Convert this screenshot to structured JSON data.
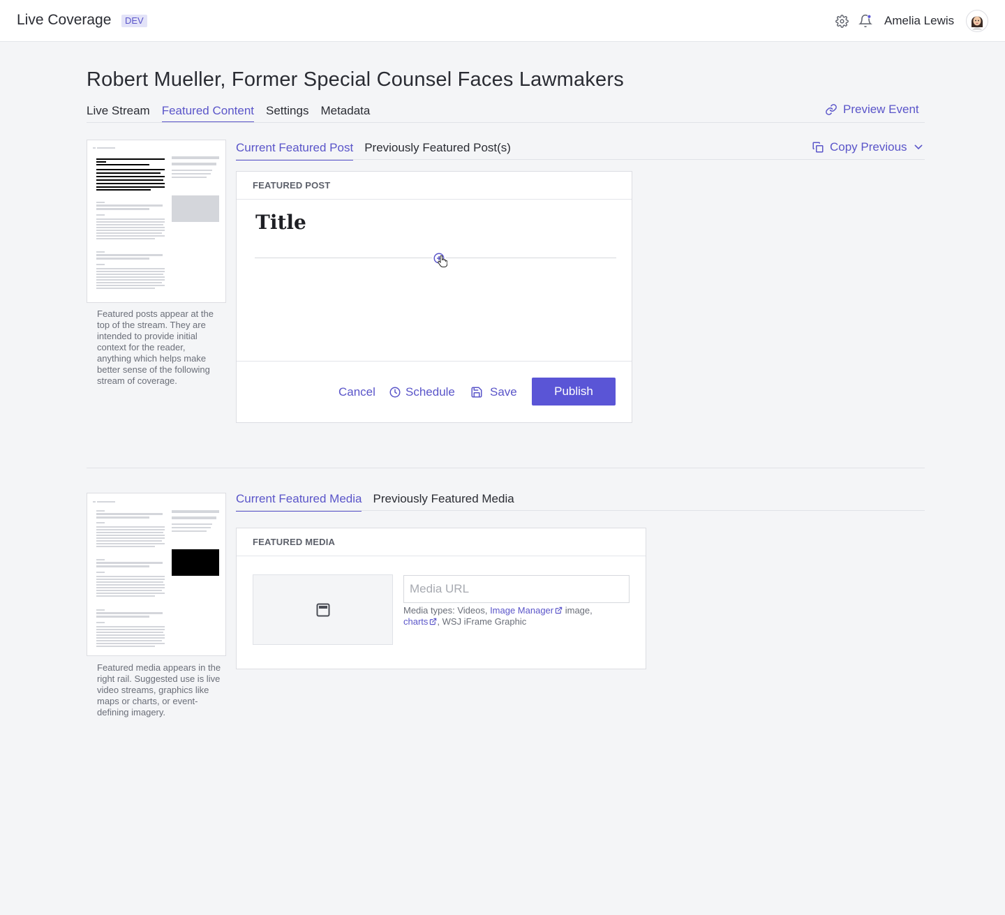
{
  "app": {
    "title": "Live Coverage",
    "env_badge": "DEV"
  },
  "header": {
    "user_name": "Amelia Lewis",
    "icons": [
      "gear-icon",
      "bell-icon",
      "avatar"
    ],
    "accent_color": "#5a55c9"
  },
  "page": {
    "title": "Robert Mueller, Former Special Counsel Faces Lawmakers",
    "tabs": [
      {
        "label": "Live Stream",
        "active": false
      },
      {
        "label": "Featured Content",
        "active": true
      },
      {
        "label": "Settings",
        "active": false
      },
      {
        "label": "Metadata",
        "active": false
      }
    ],
    "preview_label": "Preview Event"
  },
  "featured_post": {
    "tabs": [
      {
        "label": "Current Featured Post",
        "active": true
      },
      {
        "label": "Previously Featured Post(s)",
        "active": false
      }
    ],
    "copy_previous_label": "Copy Previous",
    "card_header": "FEATURED POST",
    "title_placeholder": "Title",
    "description": "Featured posts appear at the top of the stream. They are intended to provide initial context for the reader, anything which helps make better sense of the following stream of coverage.",
    "actions": {
      "cancel": "Cancel",
      "schedule": "Schedule",
      "save": "Save",
      "publish": "Publish"
    }
  },
  "featured_media": {
    "tabs": [
      {
        "label": "Current Featured Media",
        "active": true
      },
      {
        "label": "Previously Featured Media",
        "active": false
      }
    ],
    "card_header": "FEATURED MEDIA",
    "url_placeholder": "Media URL",
    "help_prefix": "Media types: Videos, ",
    "link_image_manager": "Image Manager",
    "help_middle": " image,",
    "link_charts": "charts",
    "help_suffix": ", WSJ iFrame Graphic",
    "description": "Featured media appears in the right rail. Suggested use is live video streams, graphics like maps or charts, or event-defining imagery."
  }
}
